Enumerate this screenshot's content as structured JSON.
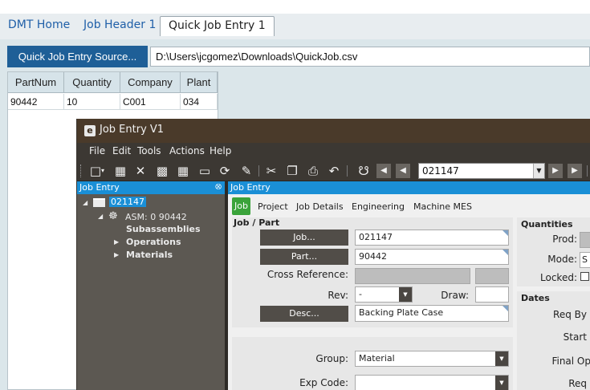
{
  "top_tabs": [
    "DMT Home",
    "Job Header 1",
    "Quick Job Entry 1"
  ],
  "source_button": "Quick Job Entry Source...",
  "source_path": "D:\\Users\\jcgomez\\Downloads\\QuickJob.csv",
  "grid": {
    "columns": [
      "PartNum",
      "Quantity",
      "Company",
      "Plant"
    ],
    "rows": [
      [
        "90442",
        "10",
        "C001",
        "034"
      ]
    ]
  },
  "window": {
    "title": "Job Entry V1",
    "menu": [
      "File",
      "Edit",
      "Tools",
      "Actions",
      "Help"
    ],
    "job_combo": "021147"
  },
  "tree": {
    "header": "Job Entry",
    "pin": "⭙",
    "job": "021147",
    "asm": "ASM: 0 90442",
    "items": [
      "Subassemblies",
      "Operations",
      "Materials"
    ]
  },
  "job_pane": {
    "header": "Job Entry",
    "tabs": [
      "Job",
      "Project",
      "Job Details",
      "Engineering",
      "Machine MES"
    ],
    "section": "Job / Part",
    "buttons": {
      "job": "Job...",
      "part": "Part...",
      "desc": "Desc..."
    },
    "labels": {
      "cross_ref": "Cross Reference:",
      "rev": "Rev:",
      "draw": "Draw:",
      "group": "Group:",
      "exp_code": "Exp Code:"
    },
    "values": {
      "job": "021147",
      "part": "90442",
      "rev": "-",
      "desc": "Backing Plate Case",
      "group": "Material",
      "exp_code": ""
    },
    "quantities_title": "Quantities",
    "quantity_labels": [
      "Prod:",
      "Mode:",
      "Locked:"
    ],
    "mode_value": "S",
    "dates_title": "Dates",
    "date_labels": [
      "Req By",
      "Start",
      "Final Op",
      "Req"
    ]
  }
}
